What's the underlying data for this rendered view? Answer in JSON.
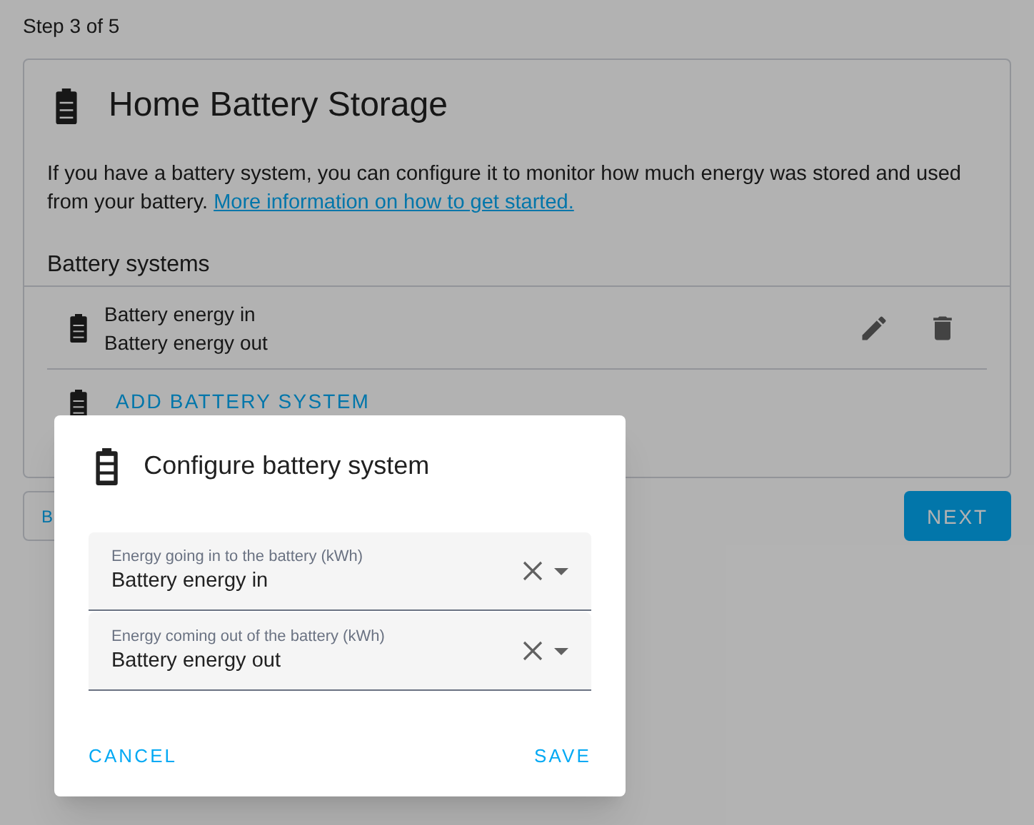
{
  "step": "Step 3 of 5",
  "card": {
    "title": "Home Battery Storage",
    "description": "If you have a battery system, you can configure it to monitor how much energy was stored and used from your battery.",
    "link": "More information on how to get started.",
    "section_title": "Battery systems",
    "systems": [
      {
        "energy_in": "Battery energy in",
        "energy_out": "Battery energy out"
      }
    ],
    "add_label": "ADD BATTERY SYSTEM"
  },
  "nav_buttons": [
    {
      "label": "B",
      "kind": "outlined"
    },
    {
      "label": "NEXT",
      "kind": "filled"
    }
  ],
  "dialog": {
    "title": "Configure battery system",
    "fields": [
      {
        "label": "Energy going in to the battery (kWh)",
        "value": "Battery energy in"
      },
      {
        "label": "Energy coming out of the battery (kWh)",
        "value": "Battery energy out"
      }
    ],
    "cancel": "CANCEL",
    "save": "SAVE"
  }
}
